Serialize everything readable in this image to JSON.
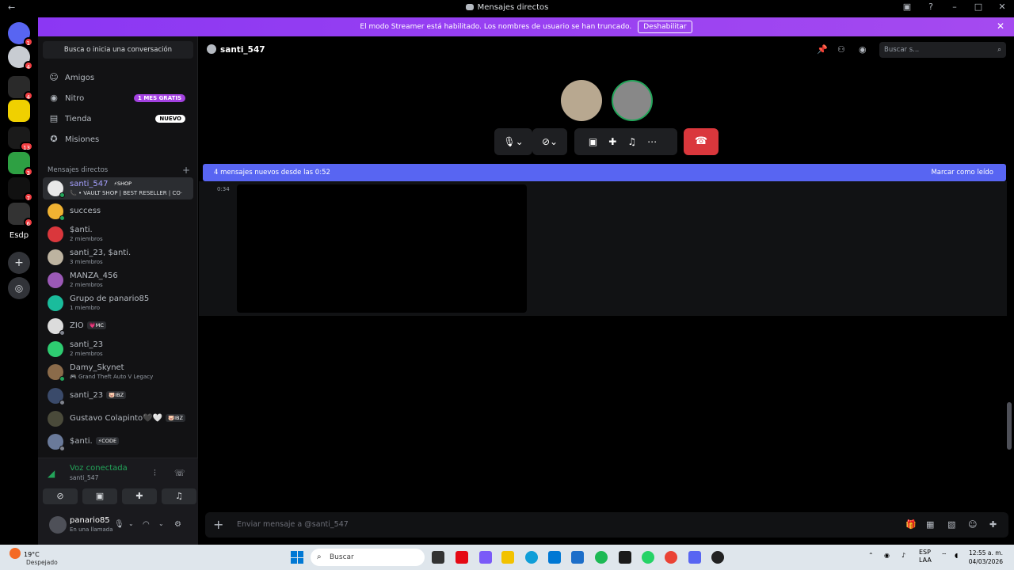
{
  "window": {
    "title": "Mensajes directos"
  },
  "banner": {
    "text": "El modo Streamer está habilitado. Los nombres de usuario se han truncado.",
    "button": "Deshabilitar"
  },
  "servers": {
    "items": [
      {
        "badge": "1"
      },
      {
        "badge": "4"
      },
      {
        "badge": "4"
      },
      {
        "badge": ""
      },
      {
        "badge": "13"
      },
      {
        "badge": "3"
      },
      {
        "badge": "7"
      },
      {
        "badge": "6"
      }
    ],
    "text_item": "Esdp"
  },
  "sidebar": {
    "search_placeholder": "Busca o inicia una conversación",
    "nav": [
      {
        "label": "Amigos",
        "pill": ""
      },
      {
        "label": "Nitro",
        "pill": "1 MES GRATIS"
      },
      {
        "label": "Tienda",
        "pill": "NUEVO"
      },
      {
        "label": "Misiones",
        "pill": ""
      }
    ],
    "dm_header": "Mensajes directos",
    "dms": [
      {
        "name": "santi_547",
        "tag": "⚡SHOP",
        "sub": "📞 • VAULT SHOP | BEST RESELLER | CO·",
        "active": true,
        "color": "#ffffff"
      },
      {
        "name": "success",
        "tag": "",
        "sub": "",
        "color": "#f0b232"
      },
      {
        "name": "$anti.",
        "tag": "",
        "sub": "2 miembros",
        "color": "#da373c"
      },
      {
        "name": "santi_23, $anti.",
        "tag": "",
        "sub": "3 miembros",
        "color": "#bdb3a0"
      },
      {
        "name": "MANZA_456",
        "tag": "",
        "sub": "2 miembros",
        "color": "#9b59b6"
      },
      {
        "name": "Grupo de panario85",
        "tag": "",
        "sub": "1 miembro",
        "color": "#1abc9c"
      },
      {
        "name": "ZIO",
        "tag": "💗MC",
        "sub": "",
        "color": "#dcdcdc"
      },
      {
        "name": "santi_23",
        "tag": "",
        "sub": "2 miembros",
        "color": "#2ecc71"
      },
      {
        "name": "Damy_Skynet",
        "tag": "",
        "sub": "🎮 Grand Theft Auto V Legacy",
        "color": "#8b6b4a"
      },
      {
        "name": "santi_23",
        "tag": "🐷IBZ",
        "sub": "",
        "color": "#3a4a6a"
      },
      {
        "name": "Gustavo Colapinto🖤🤍",
        "tag": "🐷IBZ",
        "sub": "",
        "color": "#4a4a3a"
      },
      {
        "name": "$anti.",
        "tag": "⚡CODE",
        "sub": "",
        "color": "#6a7a9a"
      }
    ]
  },
  "voice": {
    "title": "Voz conectada",
    "channel": "santi_547"
  },
  "user": {
    "name": "panario85",
    "status": "En una llamada"
  },
  "channel": {
    "name": "santi_547",
    "search_placeholder": "Buscar s..."
  },
  "new_messages": {
    "text": "4 mensajes nuevos desde las 0:52",
    "mark_read": "Marcar como leído"
  },
  "message": {
    "time": "0:34"
  },
  "composer": {
    "placeholder": "Enviar mensaje a @santi_547"
  },
  "taskbar": {
    "temp": "19°C",
    "weather": "Despejado",
    "search": "Buscar",
    "lang": "ESP",
    "lang2": "LAA",
    "time": "12:55 a. m.",
    "date": "04/03/2026"
  }
}
